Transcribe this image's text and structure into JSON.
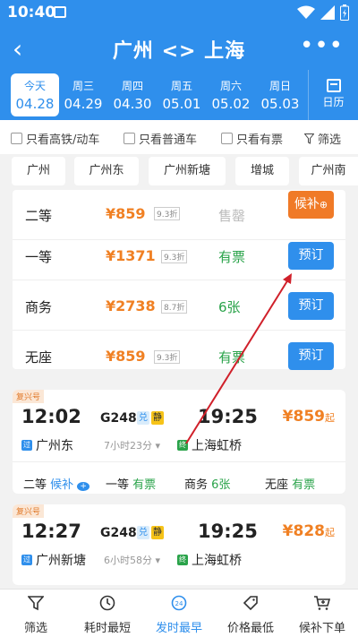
{
  "status": {
    "time": "10:40"
  },
  "nav": {
    "back": "‹",
    "title": "广州 <> 上海",
    "more": "•••"
  },
  "dates": [
    {
      "weekday": "今天",
      "date": "04.28",
      "active": true
    },
    {
      "weekday": "周三",
      "date": "04.29"
    },
    {
      "weekday": "周四",
      "date": "04.30"
    },
    {
      "weekday": "周五",
      "date": "05.01"
    },
    {
      "weekday": "周六",
      "date": "05.02"
    },
    {
      "weekday": "周日",
      "date": "05.03"
    }
  ],
  "calendar": {
    "label": "日历"
  },
  "filters": {
    "high_speed": "只看高铁/动车",
    "regular": "只看普通车",
    "available": "只看有票",
    "filter": "筛选"
  },
  "stations": [
    "广州",
    "广州东",
    "广州新塘",
    "增城",
    "广州南"
  ],
  "seats": [
    {
      "name": "二等",
      "price": "¥859",
      "discount": "9.3折",
      "status": "售罄",
      "button": "候补"
    },
    {
      "name": "一等",
      "price": "¥1371",
      "discount": "9.3折",
      "status": "有票",
      "button": "预订"
    },
    {
      "name": "商务",
      "price": "¥2738",
      "discount": "8.7折",
      "status": "6张",
      "button": "预订"
    },
    {
      "name": "无座",
      "price": "¥859",
      "discount": "9.3折",
      "status": "有票",
      "button": "预订"
    }
  ],
  "trains": [
    {
      "tag": "复兴号",
      "dep_time": "12:02",
      "number": "G248",
      "badge1": "兑",
      "badge2": "静",
      "arr_time": "19:25",
      "price": "¥859",
      "price_suffix": "起",
      "from_icon": "过",
      "from": "广州东",
      "duration": "7小时23分",
      "to_icon": "终",
      "to": "上海虹桥",
      "summary": [
        {
          "seat": "二等",
          "status": "候补"
        },
        {
          "seat": "一等",
          "status": "有票"
        },
        {
          "seat": "商务",
          "status": "6张"
        },
        {
          "seat": "无座",
          "status": "有票"
        }
      ]
    },
    {
      "tag": "复兴号",
      "dep_time": "12:27",
      "number": "G248",
      "badge1": "兑",
      "badge2": "静",
      "arr_time": "19:25",
      "price": "¥828",
      "price_suffix": "起",
      "from_icon": "过",
      "from": "广州新塘",
      "duration": "6小时58分",
      "to_icon": "终",
      "to": "上海虹桥"
    }
  ],
  "tabs": [
    {
      "label": "筛选",
      "icon": "filter-icon"
    },
    {
      "label": "耗时最短",
      "icon": "timer-icon"
    },
    {
      "label": "发时最早",
      "icon": "clock-24-icon",
      "active": true
    },
    {
      "label": "价格最低",
      "icon": "price-tag-icon"
    },
    {
      "label": "候补下单",
      "icon": "cart-icon"
    }
  ],
  "colors": {
    "primary": "#2f8fec",
    "orange": "#f08023",
    "green": "#2aa34a",
    "arrow": "#d0202a"
  }
}
